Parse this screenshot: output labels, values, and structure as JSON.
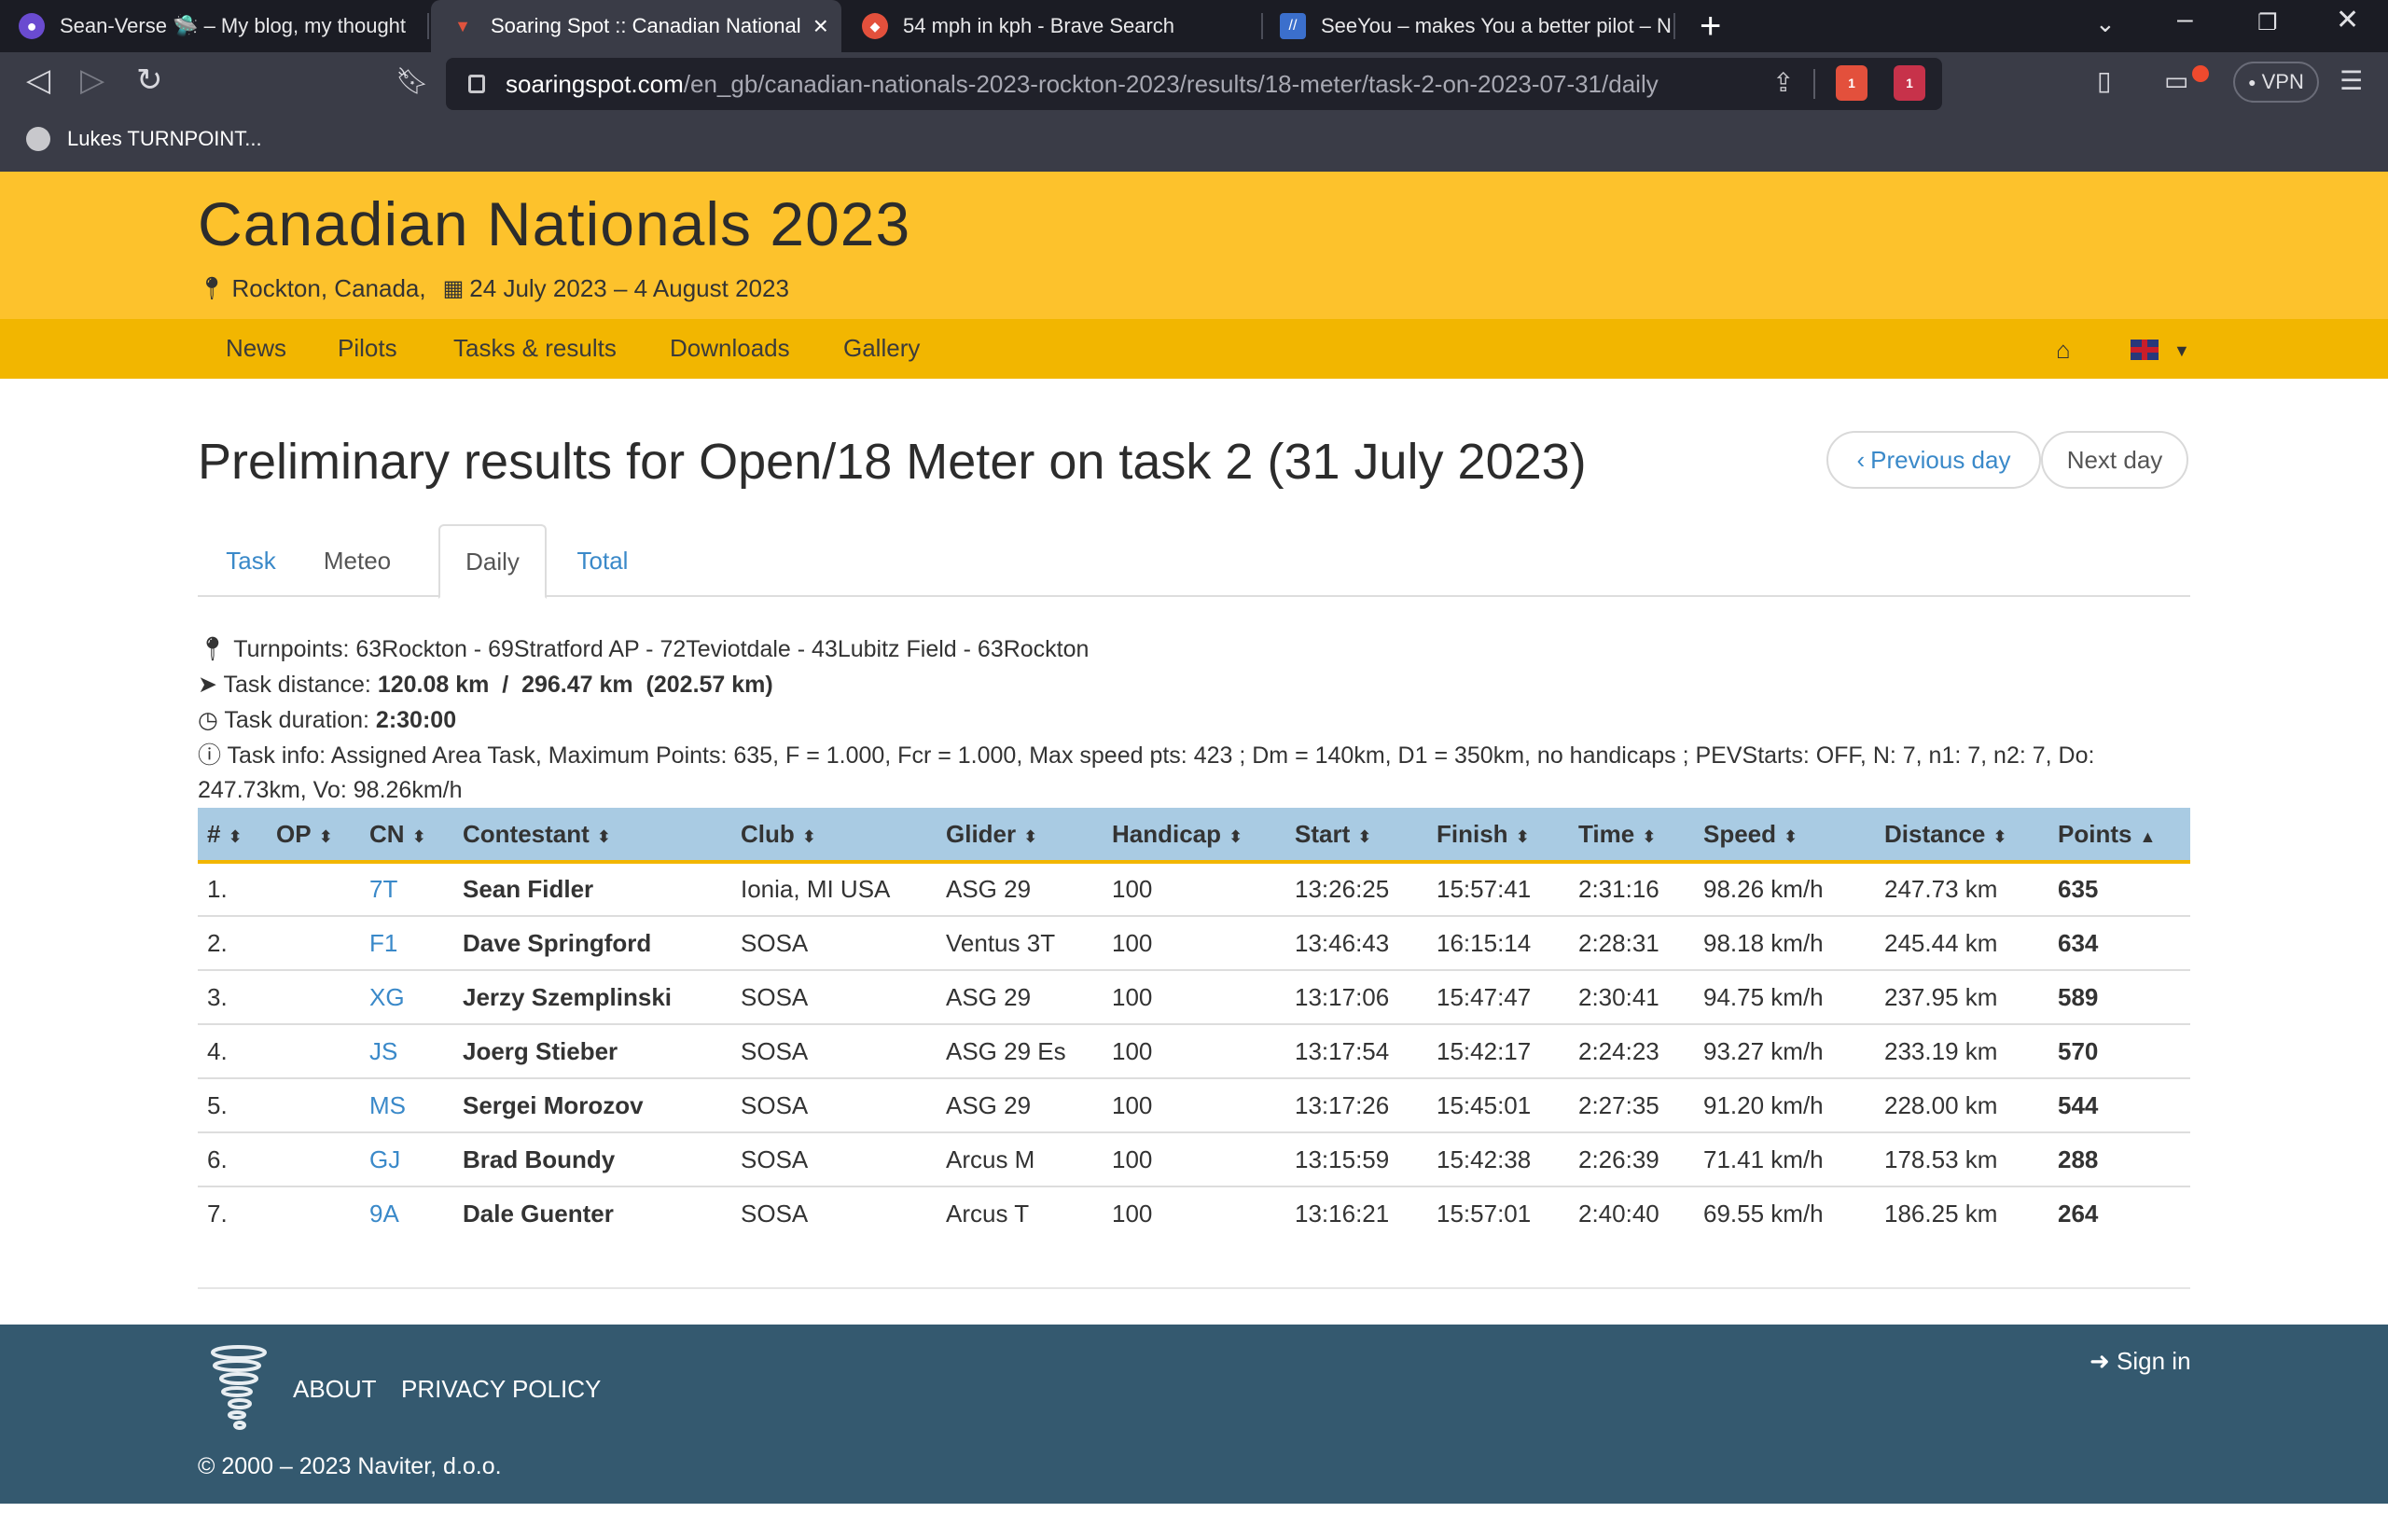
{
  "browser": {
    "tabs": [
      {
        "title": "Sean-Verse 🛸 – My blog, my thought",
        "icon": "planet-icon"
      },
      {
        "title": "Soaring Spot :: Canadian National",
        "icon": "tornado-icon"
      },
      {
        "title": "54 mph in kph - Brave Search",
        "icon": "brave-icon"
      },
      {
        "title": "SeeYou – makes You a better pilot – N",
        "icon": "seeyou-icon"
      }
    ],
    "url_host": "soaringspot.com",
    "url_path": "/en_gb/canadian-nationals-2023-rockton-2023/results/18-meter/task-2-on-2023-07-31/daily",
    "shield_badge": "1",
    "rewards_badge": "1",
    "vpn_label": "VPN",
    "bookmark": "Lukes TURNPOINT..."
  },
  "site": {
    "title": "Canadian Nationals 2023",
    "location": "Rockton, Canada,",
    "dates": "24 July 2023 – 4 August 2023",
    "nav": [
      "News",
      "Pilots",
      "Tasks & results",
      "Downloads",
      "Gallery"
    ]
  },
  "page": {
    "title": "Preliminary results for Open/18 Meter on task 2 (31 July 2023)",
    "prev_day": "Previous day",
    "next_day": "Next day",
    "tabs": [
      "Task",
      "Meteo",
      "Daily",
      "Total"
    ]
  },
  "info": {
    "turnpoints_label": "Turnpoints:",
    "turnpoints": "63Rockton - 69Stratford AP - 72Teviotdale - 43Lubitz Field - 63Rockton",
    "distance_label": "Task distance:",
    "distance": "120.08 km  /  296.47 km  (202.57 km)",
    "duration_label": "Task duration:",
    "duration": "2:30:00",
    "taskinfo_label": "Task info:",
    "taskinfo_line1": "Assigned Area Task, Maximum Points: 635, F = 1.000, Fcr = 1.000, Max speed pts: 423 ; Dm = 140km, D1 = 350km, no handicaps ; PEVStarts: OFF, N: 7, n1: 7, n2: 7, Do:",
    "taskinfo_line2": "247.73km, Vo: 98.26km/h"
  },
  "table": {
    "headers": [
      "#",
      "OP",
      "CN",
      "Contestant",
      "Club",
      "Glider",
      "Handicap",
      "Start",
      "Finish",
      "Time",
      "Speed",
      "Distance",
      "Points"
    ],
    "rows": [
      [
        "1.",
        "",
        "7T",
        "Sean Fidler",
        "Ionia, MI USA",
        "ASG 29",
        "100",
        "13:26:25",
        "15:57:41",
        "2:31:16",
        "98.26 km/h",
        "247.73 km",
        "635"
      ],
      [
        "2.",
        "",
        "F1",
        "Dave Springford",
        "SOSA",
        "Ventus 3T",
        "100",
        "13:46:43",
        "16:15:14",
        "2:28:31",
        "98.18 km/h",
        "245.44 km",
        "634"
      ],
      [
        "3.",
        "",
        "XG",
        "Jerzy Szemplinski",
        "SOSA",
        "ASG 29",
        "100",
        "13:17:06",
        "15:47:47",
        "2:30:41",
        "94.75 km/h",
        "237.95 km",
        "589"
      ],
      [
        "4.",
        "",
        "JS",
        "Joerg Stieber",
        "SOSA",
        "ASG 29 Es",
        "100",
        "13:17:54",
        "15:42:17",
        "2:24:23",
        "93.27 km/h",
        "233.19 km",
        "570"
      ],
      [
        "5.",
        "",
        "MS",
        "Sergei Morozov",
        "SOSA",
        "ASG 29",
        "100",
        "13:17:26",
        "15:45:01",
        "2:27:35",
        "91.20 km/h",
        "228.00 km",
        "544"
      ],
      [
        "6.",
        "",
        "GJ",
        "Brad Boundy",
        "SOSA",
        "Arcus M",
        "100",
        "13:15:59",
        "15:42:38",
        "2:26:39",
        "71.41 km/h",
        "178.53 km",
        "288"
      ],
      [
        "7.",
        "",
        "9A",
        "Dale Guenter",
        "SOSA",
        "Arcus T",
        "100",
        "13:16:21",
        "15:57:01",
        "2:40:40",
        "69.55 km/h",
        "186.25 km",
        "264"
      ]
    ]
  },
  "footer": {
    "about": "ABOUT",
    "privacy": "PRIVACY POLICY",
    "signin": "Sign in",
    "copyright": "© 2000 – 2023 Naviter, d.o.o."
  },
  "colors": {
    "header_yellow": "#fdc22c",
    "nav_yellow": "#f2b600",
    "table_header_blue": "#a9cbe3",
    "link_blue": "#3a89c9",
    "footer_blue": "#34596f"
  }
}
